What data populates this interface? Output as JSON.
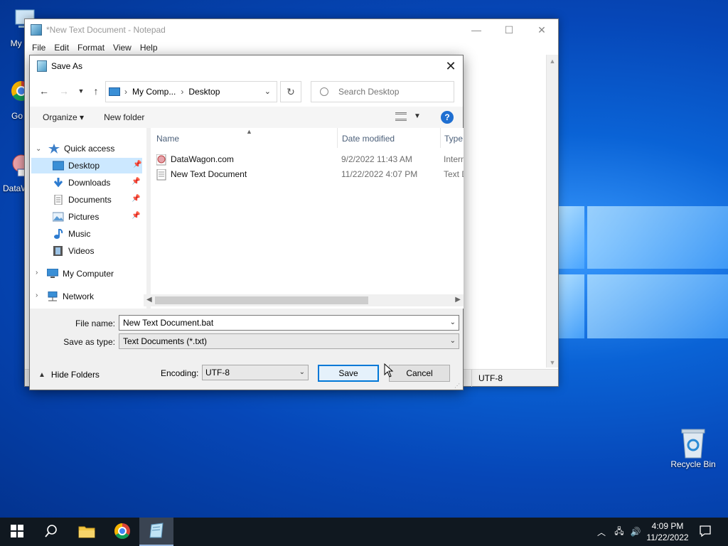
{
  "desktop": {
    "icons": [
      {
        "label": "My Co"
      },
      {
        "label": "Go Ch"
      },
      {
        "label": "DataW"
      },
      {
        "label": "Recycle Bin"
      }
    ]
  },
  "notepad": {
    "title": "*New Text Document - Notepad",
    "menu": [
      "File",
      "Edit",
      "Format",
      "View",
      "Help"
    ],
    "status_encoding": "UTF-8"
  },
  "dialog": {
    "title": "Save As",
    "address": {
      "crumbs": [
        "My Comp...",
        "Desktop"
      ]
    },
    "search_placeholder": "Search Desktop",
    "toolbar": {
      "organize": "Organize ▾",
      "new_folder": "New folder",
      "help": "?"
    },
    "nav": {
      "quick_access": "Quick access",
      "items": [
        {
          "label": "Desktop",
          "pinned": true,
          "selected": true
        },
        {
          "label": "Downloads",
          "pinned": true
        },
        {
          "label": "Documents",
          "pinned": true
        },
        {
          "label": "Pictures",
          "pinned": true
        },
        {
          "label": "Music",
          "pinned": false
        },
        {
          "label": "Videos",
          "pinned": false
        }
      ],
      "my_computer": "My Computer",
      "network": "Network"
    },
    "columns": {
      "name": "Name",
      "date": "Date modified",
      "type": "Type"
    },
    "files": [
      {
        "name": "DataWagon.com",
        "date": "9/2/2022 11:43 AM",
        "type": "Intern"
      },
      {
        "name": "New Text Document",
        "date": "11/22/2022 4:07 PM",
        "type": "Text D"
      }
    ],
    "file_name_label": "File name:",
    "file_name_value": "New Text Document.bat",
    "save_type_label": "Save as type:",
    "save_type_value": "Text Documents (*.txt)",
    "hide_folders": "Hide Folders",
    "encoding_label": "Encoding:",
    "encoding_value": "UTF-8",
    "save": "Save",
    "cancel": "Cancel"
  },
  "taskbar": {
    "time": "4:09 PM",
    "date": "11/22/2022"
  },
  "colors": {
    "accent": "#0078d7",
    "selection": "#cce8ff",
    "taskbar": "#101820"
  }
}
